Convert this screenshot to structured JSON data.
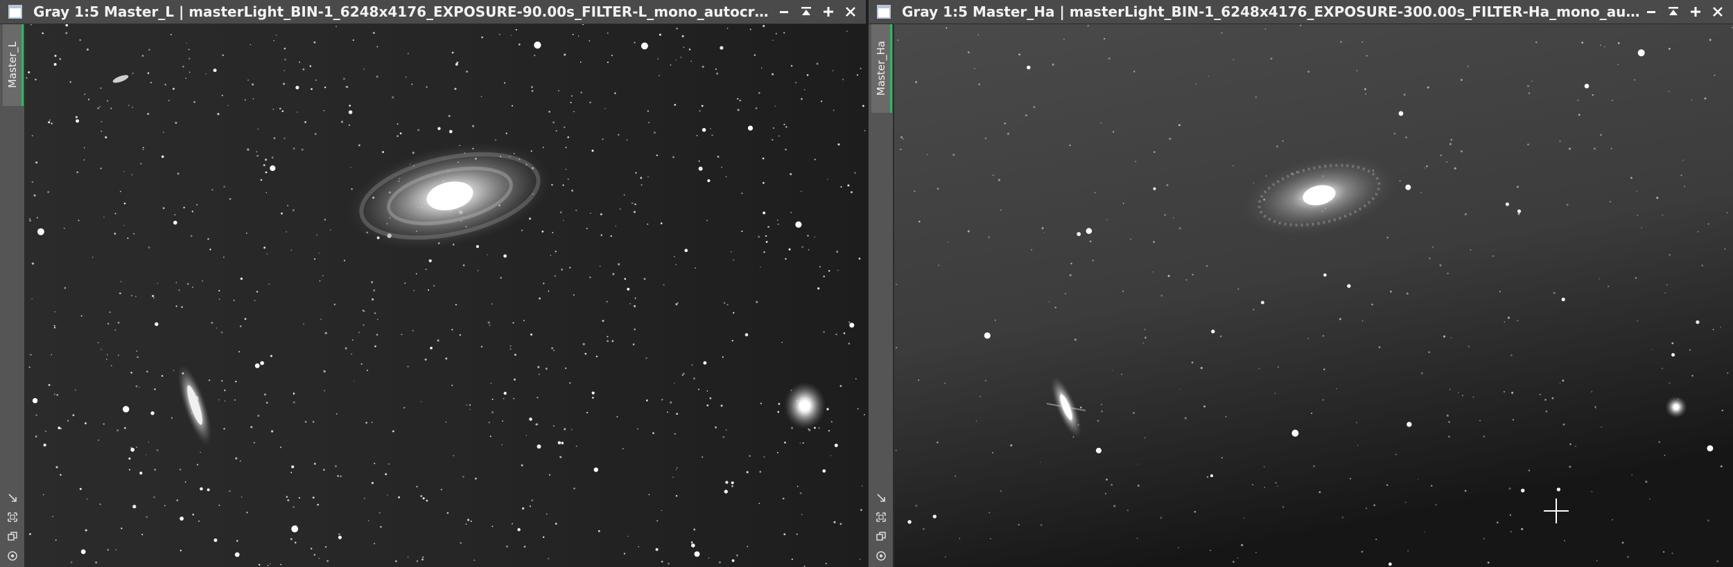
{
  "windows": [
    {
      "title": "Gray 1:5 Master_L | masterLight_BIN-1_6248x4176_EXPOSURE-90.00s_FILTER-L_mono_autocrop.xisf",
      "tab_label": "Master_L"
    },
    {
      "title": "Gray 1:5 Master_Ha | masterLight_BIN-1_6248x4176_EXPOSURE-300.00s_FILTER-Ha_mono_autocrop.xisf",
      "tab_label": "Master_Ha"
    }
  ],
  "icons": {
    "window": "window-icon",
    "minimize": "minimize-icon",
    "shade": "shade-icon",
    "maximize": "maximize-icon",
    "close": "close-icon",
    "side": [
      "resize-arrow-icon",
      "fit-view-icon",
      "clone-view-icon",
      "target-icon"
    ]
  },
  "colors": {
    "active_tab_accent": "#1fbf5a"
  }
}
